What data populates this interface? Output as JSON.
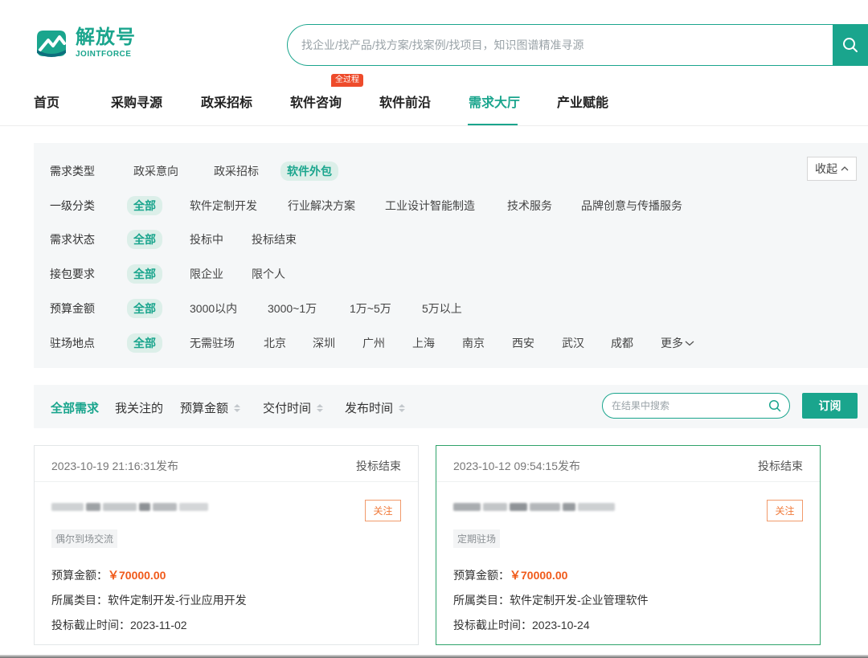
{
  "brand": {
    "name_cn": "解放号",
    "name_en": "JOINTFORCE",
    "color": "#1aa58d"
  },
  "search": {
    "placeholder": "找企业/找产品/找方案/找案例/找项目，知识图谱精准寻源"
  },
  "nav": {
    "items": [
      {
        "label": "首页"
      },
      {
        "label": "采购寻源"
      },
      {
        "label": "政采招标"
      },
      {
        "label": "软件咨询",
        "badge": "全过程"
      },
      {
        "label": "软件前沿"
      },
      {
        "label": "需求大厅",
        "active": true
      },
      {
        "label": "产业赋能"
      }
    ]
  },
  "filters": {
    "collapse_label": "收起",
    "rows": [
      {
        "label": "需求类型",
        "options": [
          "政采意向",
          "政采招标",
          "软件外包"
        ],
        "selected": "软件外包"
      },
      {
        "label": "一级分类",
        "options": [
          "全部",
          "软件定制开发",
          "行业解决方案",
          "工业设计智能制造",
          "技术服务",
          "品牌创意与传播服务"
        ],
        "selected": "全部"
      },
      {
        "label": "需求状态",
        "options": [
          "全部",
          "投标中",
          "投标结束"
        ],
        "selected": "全部"
      },
      {
        "label": "接包要求",
        "options": [
          "全部",
          "限企业",
          "限个人"
        ],
        "selected": "全部"
      },
      {
        "label": "预算金额",
        "options": [
          "全部",
          "3000以内",
          "3000~1万",
          "1万~5万",
          "5万以上"
        ],
        "selected": "全部"
      },
      {
        "label": "驻场地点",
        "options": [
          "全部",
          "无需驻场",
          "北京",
          "深圳",
          "广州",
          "上海",
          "南京",
          "西安",
          "武汉",
          "成都",
          "更多"
        ],
        "selected": "全部"
      }
    ]
  },
  "sort_bar": {
    "all": "全部需求",
    "mine": "我关注的",
    "sorts": [
      "预算金额",
      "交付时间",
      "发布时间"
    ],
    "search_placeholder": "在结果中搜索",
    "subscribe_label": "订阅"
  },
  "cards": [
    {
      "date": "2023-10-19 21:16:31发布",
      "status": "投标结束",
      "follow_label": "关注",
      "tag": "偶尔到场交流",
      "budget_label": "预算金额：",
      "budget_value": "￥70000.00",
      "category": "所属类目：软件定制开发-行业应用开发",
      "deadline": "投标截止时间：2023-11-02"
    },
    {
      "date": "2023-10-12 09:54:15发布",
      "status": "投标结束",
      "follow_label": "关注",
      "tag": "定期驻场",
      "budget_label": "预算金额：",
      "budget_value": "￥70000.00",
      "category": "所属类目：软件定制开发-企业管理软件",
      "deadline": "投标截止时间：2023-10-24"
    }
  ]
}
